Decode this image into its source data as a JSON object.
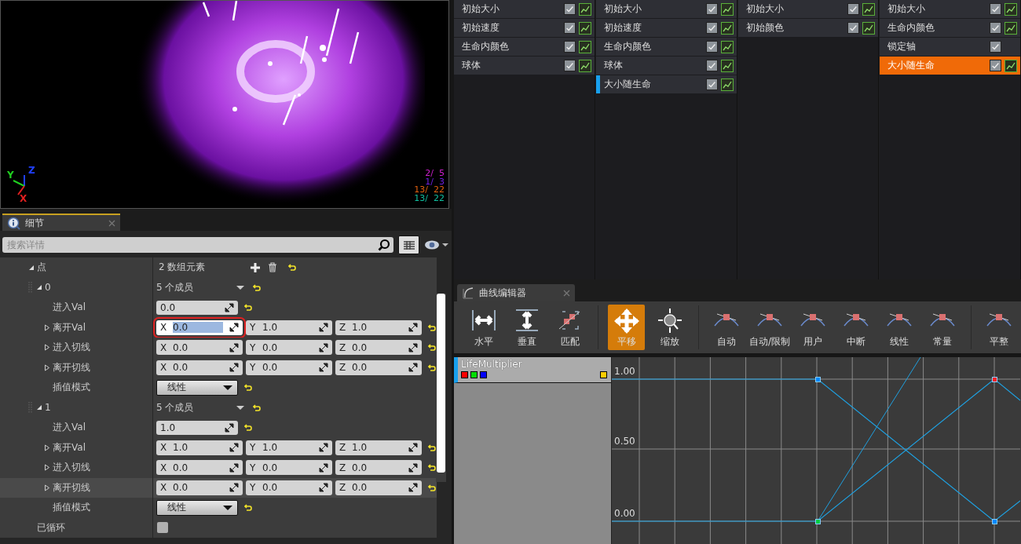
{
  "viewport": {
    "axes": [
      {
        "label": "Z",
        "color": "#2040ff"
      },
      {
        "label": "Y",
        "color": "#20d020"
      },
      {
        "label": "X",
        "color": "#e02020"
      }
    ],
    "stats": [
      {
        "text": "2/  5",
        "color": "#d020d0"
      },
      {
        "text": "1/  3",
        "color": "#7020e0"
      },
      {
        "text": "13/  22",
        "color": "#e06010"
      },
      {
        "text": "13/  22",
        "color": "#10c0a0"
      }
    ]
  },
  "details": {
    "tab": {
      "title": "细节"
    },
    "search": {
      "placeholder": "搜索详情"
    },
    "rows": [
      {
        "kind": "array",
        "label": "点",
        "expanded": true,
        "summary": "2 数组元素",
        "children": [
          {
            "kind": "struct",
            "label": "0",
            "expanded": true,
            "summary": "5 个成员",
            "children": [
              {
                "kind": "number",
                "label": "进入Val",
                "value": "0.0"
              },
              {
                "kind": "vector",
                "label": "离开Val",
                "expanded": false,
                "hovered": false,
                "fields": [
                  {
                    "axis": "X",
                    "value": "0.0",
                    "focused": true
                  },
                  {
                    "axis": "Y",
                    "value": "1.0",
                    "focused": false
                  },
                  {
                    "axis": "Z",
                    "value": "1.0",
                    "focused": false
                  }
                ]
              },
              {
                "kind": "vector",
                "label": "进入切线",
                "expanded": false,
                "hovered": false,
                "fields": [
                  {
                    "axis": "X",
                    "value": "0.0",
                    "focused": false
                  },
                  {
                    "axis": "Y",
                    "value": "0.0",
                    "focused": false
                  },
                  {
                    "axis": "Z",
                    "value": "0.0",
                    "focused": false
                  }
                ]
              },
              {
                "kind": "vector",
                "label": "离开切线",
                "expanded": false,
                "hovered": false,
                "fields": [
                  {
                    "axis": "X",
                    "value": "0.0",
                    "focused": false
                  },
                  {
                    "axis": "Y",
                    "value": "0.0",
                    "focused": false
                  },
                  {
                    "axis": "Z",
                    "value": "0.0",
                    "focused": false
                  }
                ]
              },
              {
                "kind": "dropdown",
                "label": "插值模式",
                "value": "线性"
              }
            ]
          },
          {
            "kind": "struct",
            "label": "1",
            "expanded": true,
            "summary": "5 个成员",
            "children": [
              {
                "kind": "number",
                "label": "进入Val",
                "value": "1.0"
              },
              {
                "kind": "vector",
                "label": "离开Val",
                "expanded": false,
                "hovered": false,
                "fields": [
                  {
                    "axis": "X",
                    "value": "1.0",
                    "focused": false
                  },
                  {
                    "axis": "Y",
                    "value": "1.0",
                    "focused": false
                  },
                  {
                    "axis": "Z",
                    "value": "1.0",
                    "focused": false
                  }
                ]
              },
              {
                "kind": "vector",
                "label": "进入切线",
                "expanded": false,
                "hovered": false,
                "fields": [
                  {
                    "axis": "X",
                    "value": "0.0",
                    "focused": false
                  },
                  {
                    "axis": "Y",
                    "value": "0.0",
                    "focused": false
                  },
                  {
                    "axis": "Z",
                    "value": "0.0",
                    "focused": false
                  }
                ]
              },
              {
                "kind": "vector",
                "label": "离开切线",
                "expanded": false,
                "hovered": true,
                "fields": [
                  {
                    "axis": "X",
                    "value": "0.0",
                    "focused": false
                  },
                  {
                    "axis": "Y",
                    "value": "0.0",
                    "focused": false
                  },
                  {
                    "axis": "Z",
                    "value": "0.0",
                    "focused": false
                  }
                ]
              },
              {
                "kind": "dropdown",
                "label": "插值模式",
                "value": "线性"
              }
            ]
          }
        ]
      },
      {
        "kind": "checkbox",
        "label": "已循环",
        "checked": false
      }
    ]
  },
  "emitters": [
    {
      "modules": [
        {
          "label": "初始大小",
          "enabled": true,
          "has_curve": true,
          "selected": false,
          "marked": false
        },
        {
          "label": "初始速度",
          "enabled": true,
          "has_curve": true,
          "selected": false,
          "marked": false
        },
        {
          "label": "生命内颜色",
          "enabled": true,
          "has_curve": true,
          "selected": false,
          "marked": false
        },
        {
          "label": "球体",
          "enabled": true,
          "has_curve": true,
          "selected": false,
          "marked": false
        }
      ]
    },
    {
      "modules": [
        {
          "label": "初始大小",
          "enabled": true,
          "has_curve": true,
          "selected": false,
          "marked": false
        },
        {
          "label": "初始速度",
          "enabled": true,
          "has_curve": true,
          "selected": false,
          "marked": false
        },
        {
          "label": "生命内颜色",
          "enabled": true,
          "has_curve": true,
          "selected": false,
          "marked": false
        },
        {
          "label": "球体",
          "enabled": true,
          "has_curve": true,
          "selected": false,
          "marked": false
        },
        {
          "label": "大小随生命",
          "enabled": true,
          "has_curve": true,
          "selected": false,
          "marked": true
        }
      ]
    },
    {
      "modules": [
        {
          "label": "初始大小",
          "enabled": true,
          "has_curve": true,
          "selected": false,
          "marked": false
        },
        {
          "label": "初始颜色",
          "enabled": true,
          "has_curve": true,
          "selected": false,
          "marked": false
        }
      ]
    },
    {
      "modules": [
        {
          "label": "初始大小",
          "enabled": true,
          "has_curve": true,
          "selected": false,
          "marked": false
        },
        {
          "label": "生命内颜色",
          "enabled": true,
          "has_curve": true,
          "selected": false,
          "marked": false
        },
        {
          "label": "锁定轴",
          "enabled": true,
          "has_curve": false,
          "selected": false,
          "marked": false
        },
        {
          "label": "大小随生命",
          "enabled": true,
          "has_curve": true,
          "selected": true,
          "marked": false
        }
      ]
    }
  ],
  "curve_editor": {
    "tab": {
      "title": "曲线编辑器"
    },
    "toolbar": [
      [
        {
          "label": "水平",
          "selected": false
        },
        {
          "label": "垂直",
          "selected": false
        },
        {
          "label": "匹配",
          "selected": false
        }
      ],
      [
        {
          "label": "平移",
          "selected": true
        },
        {
          "label": "缩放",
          "selected": false
        }
      ],
      [
        {
          "label": "自动",
          "selected": false
        },
        {
          "label": "自动/限制",
          "selected": false
        },
        {
          "label": "用户",
          "selected": false
        },
        {
          "label": "中断",
          "selected": false
        },
        {
          "label": "线性",
          "selected": false
        },
        {
          "label": "常量",
          "selected": false
        }
      ],
      [
        {
          "label": "平整",
          "selected": false
        }
      ]
    ],
    "tracks": [
      {
        "name": "LifeMultiplier"
      }
    ],
    "y_labels": [
      "1.00",
      "0.50",
      "0.00"
    ]
  }
}
